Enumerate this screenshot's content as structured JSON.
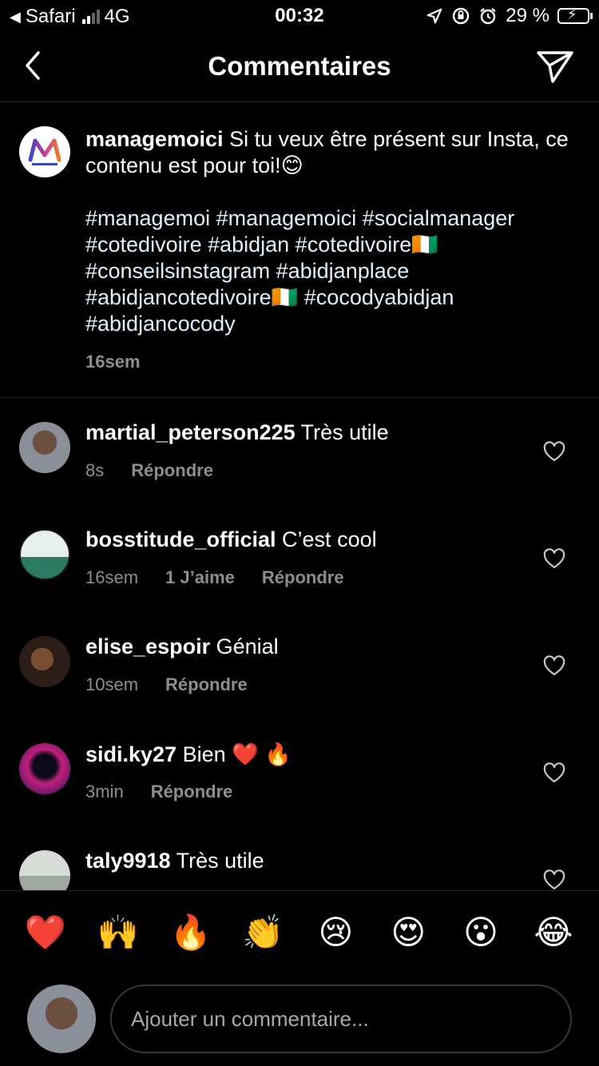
{
  "status_bar": {
    "back_app": "Safari",
    "network": "4G",
    "time": "00:32",
    "battery_percent": "29 %",
    "battery_level": 0.29,
    "accent_battery_color": "#4cd964"
  },
  "header": {
    "title": "Commentaires",
    "back_icon": "chevron-left-icon",
    "send_icon": "paper-plane-icon"
  },
  "caption": {
    "username": "managemoici",
    "text": "Si tu veux être présent sur Insta, ce contenu est pour toi!😊",
    "hashtags_lines": [
      "#managemoi #managemoici #socialmanager",
      "#cotedivoire #abidjan #cotedivoire🇨🇮",
      "#conseilsinstagram #abidjanplace",
      "#abidjancotedivoire🇨🇮 #cocodyabidjan",
      "#abidjancocody"
    ],
    "time": "16sem"
  },
  "comments": [
    {
      "username": "martial_peterson225",
      "text": "Très utile",
      "time": "8s",
      "likes": "",
      "reply": "Répondre"
    },
    {
      "username": "bosstitude_official",
      "text": "C’est cool",
      "time": "16sem",
      "likes": "1 J’aime",
      "reply": "Répondre"
    },
    {
      "username": "elise_espoir",
      "text": "Génial",
      "time": "10sem",
      "likes": "",
      "reply": "Répondre"
    },
    {
      "username": "sidi.ky27",
      "text": "Bien ❤️ 🔥",
      "time": "3min",
      "likes": "",
      "reply": "Répondre"
    },
    {
      "username": "taly9918",
      "text": "Très utile",
      "time": "",
      "likes": "",
      "reply": ""
    }
  ],
  "emoji_bar": [
    "❤️",
    "🙌",
    "🔥",
    "👏",
    "😢",
    "😍",
    "😮",
    "😂"
  ],
  "composer": {
    "placeholder": "Ajouter un commentaire..."
  }
}
